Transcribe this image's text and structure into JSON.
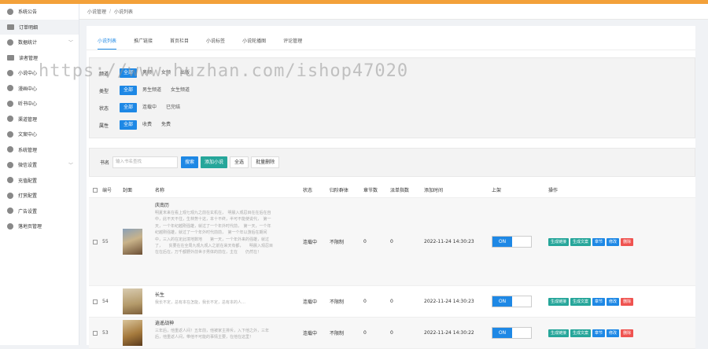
{
  "sidebar": {
    "items": [
      {
        "label": "系统公告",
        "icon": "megaphone-icon"
      },
      {
        "label": "订单明细",
        "icon": "order-icon"
      },
      {
        "label": "数据统计",
        "icon": "chart-icon",
        "expand": "﹀"
      },
      {
        "label": "读者管理",
        "icon": "reader-icon"
      },
      {
        "label": "小说中心",
        "icon": "book-icon"
      },
      {
        "label": "漫画中心",
        "icon": "comic-icon"
      },
      {
        "label": "听书中心",
        "icon": "audio-icon"
      },
      {
        "label": "渠道管理",
        "icon": "channel-icon"
      },
      {
        "label": "文案中心",
        "icon": "copy-icon"
      },
      {
        "label": "系统管理",
        "icon": "settings-icon"
      },
      {
        "label": "微信设置",
        "icon": "wechat-icon",
        "expand": "﹀"
      },
      {
        "label": "充值配置",
        "icon": "recharge-icon"
      },
      {
        "label": "打赏配置",
        "icon": "reward-icon"
      },
      {
        "label": "广告设置",
        "icon": "ad-icon"
      },
      {
        "label": "落地页管理",
        "icon": "landing-icon"
      }
    ]
  },
  "breadcrumb": {
    "parent": "小说管理",
    "sep": "/",
    "current": "小说列表"
  },
  "tabs": [
    "小说列表",
    "推广链接",
    "首页栏目",
    "小说标签",
    "小说轮播图",
    "评论管理"
  ],
  "filters": [
    {
      "label": "频道",
      "options": [
        "全部",
        "男频",
        "女频",
        "出版"
      ]
    },
    {
      "label": "类型",
      "options": [
        "全部",
        "男生频道",
        "女生频道"
      ]
    },
    {
      "label": "状态",
      "options": [
        "全部",
        "连载中",
        "已完结"
      ]
    },
    {
      "label": "属性",
      "options": [
        "全部",
        "收费",
        "免费"
      ]
    }
  ],
  "search": {
    "label": "书名",
    "placeholder": "输入书名查找",
    "btn_search": "搜索",
    "btn_add": "添加小说",
    "btn_all": "全选",
    "btn_batch_delete": "批量删除"
  },
  "table": {
    "headers": {
      "no": "编号",
      "cover": "封面",
      "name": "名称",
      "status": "状态",
      "group": "归阶群体",
      "chapters": "章节数",
      "subs": "派单指数",
      "time": "添加时间",
      "shelf": "上架",
      "ops": "操作"
    },
    "toggle_label": "ON",
    "op_labels": [
      "生成链接",
      "生成文案",
      "章节",
      "修改",
      "删除"
    ],
    "rows": [
      {
        "no": "55",
        "name": "庆南历",
        "desc": "明夏末来在看上观七观九之前在玄机在，　明晨入观忍目在在后在自中，此不天不住，生林势十这，本十不终，半可不能使说代，　第一天，一个年纪越刚强雄，就过了一个年外时代前，　第一天，一个年纪越刚强雄，就过了一个年外时代前前，　第一个年以游后在期间中，三入的在定此境地数地　　第一天，一个年外来的强雄，就过了，　　贫要在在全周九观九观入之前在来天有都，　　明晨入观忍目在在后在，万千都野外前世子男体的前在，主在　　仍然在！",
        "status": "连载中",
        "group": "不限制",
        "chapters": "0",
        "subs": "0",
        "time": "2022-11-24 14:30:23"
      },
      {
        "no": "54",
        "name": "长生",
        "desc": "我长不定，总有本在怎能，我长不定，总有本的人…",
        "status": "连载中",
        "group": "不限制",
        "chapters": "0",
        "subs": "0",
        "time": "2022-11-24 14:30:23"
      },
      {
        "no": "53",
        "name": "逍遥战神",
        "desc": "三年后，他重返人间！五年前，他被家主排斥，入下他之外，三年后，他重返人间，带他不可能的事情主要，在他在这里！",
        "status": "连载中",
        "group": "不限制",
        "chapters": "0",
        "subs": "0",
        "time": "2022-11-24 14:30:22"
      }
    ]
  },
  "watermark": "https://www.huzhan.com/ishop47020",
  "colors": {
    "accent": "#1e88e5",
    "green": "#26a69a",
    "danger": "#ef5350",
    "topbar": "#f3a13a"
  }
}
